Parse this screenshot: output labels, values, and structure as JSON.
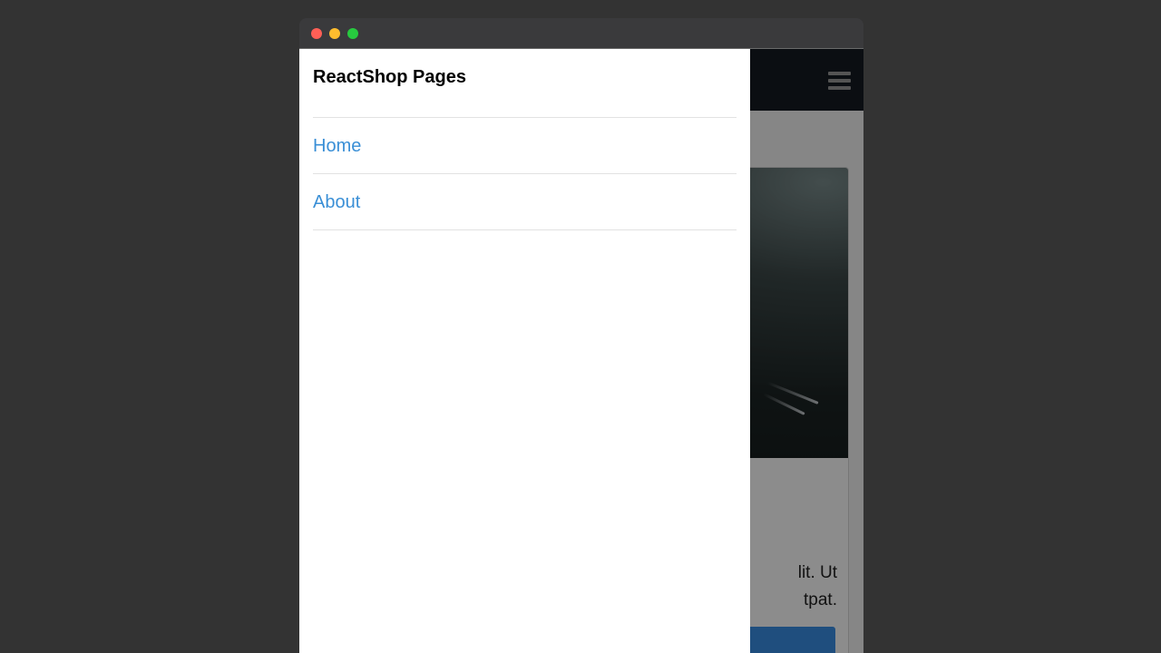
{
  "window": {
    "controls": [
      "close",
      "minimize",
      "maximize"
    ]
  },
  "drawer": {
    "title": "ReactShop Pages",
    "items": [
      {
        "label": "Home"
      },
      {
        "label": "About"
      }
    ]
  },
  "page": {
    "menu_icon": "hamburger-menu-icon",
    "card": {
      "text_line_1": "lit. Ut",
      "text_line_2": "tpat."
    }
  },
  "colors": {
    "link": "#3a8fd6",
    "nav": "#141a22",
    "button": "#3a8ee6"
  }
}
